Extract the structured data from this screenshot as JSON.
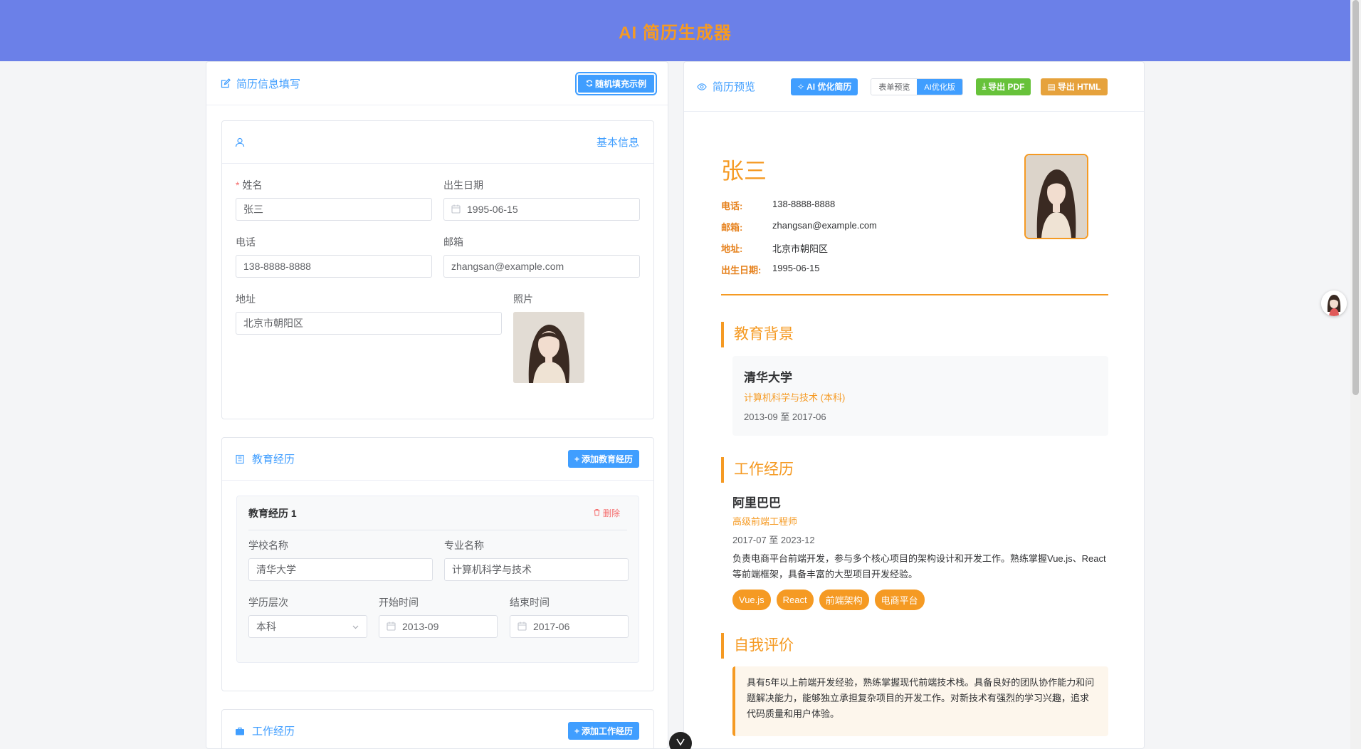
{
  "app": {
    "title": "AI 简历生成器"
  },
  "form": {
    "title": "简历信息填写",
    "random_button": "随机填充示例",
    "basic": {
      "title": "基本信息",
      "name_label": "姓名",
      "name_value": "张三",
      "birth_label": "出生日期",
      "birth_value": "1995-06-15",
      "phone_label": "电话",
      "phone_value": "138-8888-8888",
      "email_label": "邮箱",
      "email_value": "zhangsan@example.com",
      "address_label": "地址",
      "address_value": "北京市朝阳区",
      "photo_label": "照片"
    },
    "education": {
      "title": "教育经历",
      "add_button": "添加教育经历",
      "item_title": "教育经历 1",
      "delete_label": "删除",
      "school_label": "学校名称",
      "school_value": "清华大学",
      "major_label": "专业名称",
      "major_value": "计算机科学与技术",
      "degree_label": "学历层次",
      "degree_value": "本科",
      "start_label": "开始时间",
      "start_value": "2013-09",
      "end_label": "结束时间",
      "end_value": "2017-06"
    },
    "work": {
      "title": "工作经历",
      "add_button": "添加工作经历"
    }
  },
  "preview": {
    "title": "简历预览",
    "ai_optimize_button": "AI 优化简历",
    "view_form": "表单预览",
    "view_ai": "AI优化版",
    "export_pdf": "导出 PDF",
    "export_html": "导出 HTML",
    "name": "张三",
    "info": [
      {
        "key": "电话:",
        "value": "138-8888-8888"
      },
      {
        "key": "邮箱:",
        "value": "zhangsan@example.com"
      },
      {
        "key": "地址:",
        "value": "北京市朝阳区"
      },
      {
        "key": "出生日期:",
        "value": "1995-06-15"
      }
    ],
    "education_title": "教育背景",
    "edu_school": "清华大学",
    "edu_major": "计算机科学与技术 (本科)",
    "edu_date": "2013-09 至 2017-06",
    "work_title": "工作经历",
    "work_company": "阿里巴巴",
    "work_position": "高级前端工程师",
    "work_date": "2017-07 至 2023-12",
    "work_desc": "负责电商平台前端开发，参与多个核心项目的架构设计和开发工作。熟练掌握Vue.js、React等前端框架，具备丰富的大型项目开发经验。",
    "tags": [
      "Vue.js",
      "React",
      "前端架构",
      "电商平台"
    ],
    "self_title": "自我评价",
    "self_text": "具有5年以上前端开发经验，熟练掌握现代前端技术栈。具备良好的团队协作能力和问题解决能力，能够独立承担复杂项目的开发工作。对新技术有强烈的学习兴趣，追求代码质量和用户体验。"
  },
  "colors": {
    "header_bg": "#6b80e8",
    "accent_orange": "#f59a23",
    "primary_blue": "#409eff"
  },
  "icons": [
    "edit-icon",
    "refresh-icon",
    "user-icon",
    "calendar-icon",
    "school-icon",
    "plus-icon",
    "delete-icon",
    "chevron-down-icon",
    "briefcase-icon",
    "eye-icon",
    "magic-icon",
    "download-icon",
    "file-icon",
    "vue-icon"
  ]
}
